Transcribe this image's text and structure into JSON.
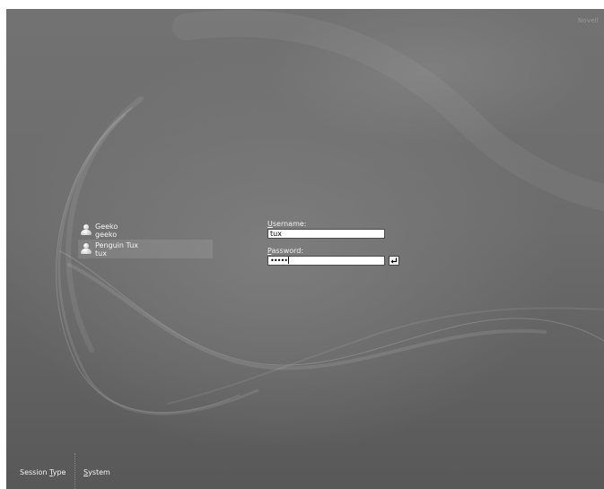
{
  "brand": {
    "text": "Novell"
  },
  "users": [
    {
      "name": "Geeko",
      "login": "geeko",
      "selected": false,
      "icon": "user-icon"
    },
    {
      "name": "Penguin Tux",
      "login": "tux",
      "selected": true,
      "icon": "user-icon"
    }
  ],
  "login": {
    "username_label_accel": "U",
    "username_label_rest": "sername:",
    "username_value": "tux",
    "password_label_accel": "P",
    "password_label_rest": "assword:",
    "password_masked": "•••••",
    "enter_icon": "enter-arrow-icon"
  },
  "bottom_menu": {
    "session_prefix": "Session ",
    "session_accel": "T",
    "session_rest": "ype",
    "system_accel": "S",
    "system_rest": "ystem"
  },
  "colors": {
    "background": "#6e6e6e",
    "text": "#f2f2f2",
    "input_bg": "#ffffff"
  }
}
